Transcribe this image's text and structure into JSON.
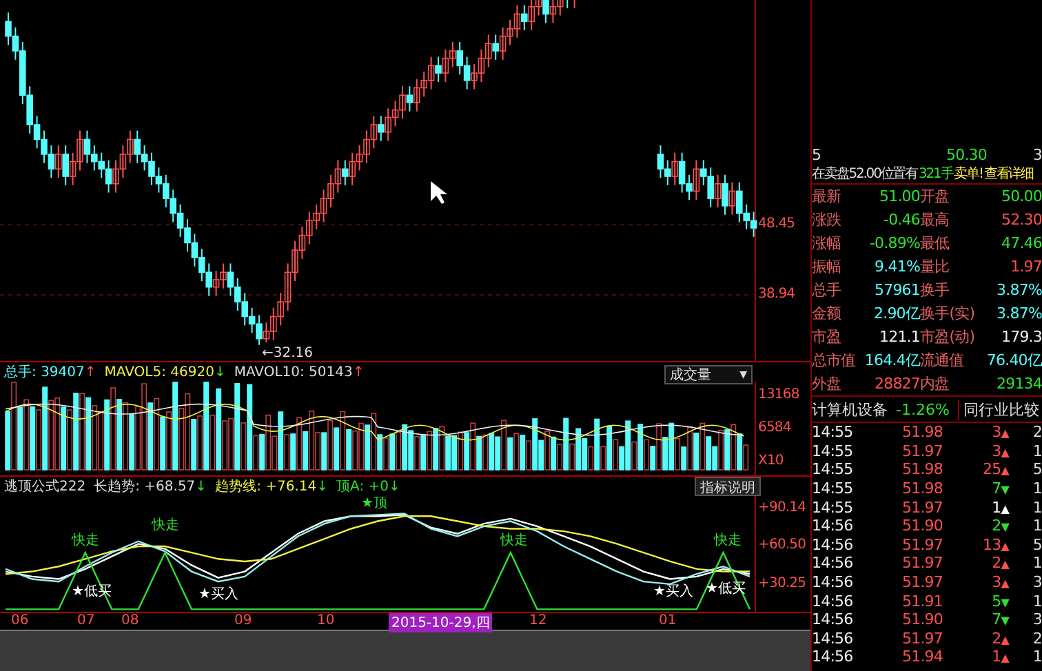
{
  "price_chart": {
    "chart_data": {
      "type": "candlestick",
      "ylim": [
        29.98,
        78.9
      ],
      "yticks": [
        {
          "value": 48.45,
          "label": "48.45"
        },
        {
          "value": 38.94,
          "label": "38.94"
        }
      ],
      "ohlc": [
        [
          76,
          77.2,
          72.8,
          74
        ],
        [
          74,
          75.2,
          70.8,
          72
        ],
        [
          72,
          73.2,
          64.8,
          66
        ],
        [
          66,
          67.2,
          60.8,
          62
        ],
        [
          62,
          63.2,
          58.8,
          60
        ],
        [
          60,
          61.2,
          56.8,
          58
        ],
        [
          58,
          59.2,
          54.8,
          56
        ],
        [
          56,
          59.2,
          54.8,
          58
        ],
        [
          58,
          59.2,
          53.8,
          55
        ],
        [
          55,
          58.2,
          53.8,
          57
        ],
        [
          57,
          61.2,
          55.8,
          60
        ],
        [
          60,
          61.2,
          56.8,
          58
        ],
        [
          58,
          59.2,
          55.8,
          57
        ],
        [
          57,
          58.2,
          54.8,
          56
        ],
        [
          56,
          57.2,
          52.8,
          54
        ],
        [
          54,
          57.2,
          52.8,
          56
        ],
        [
          56,
          59.2,
          54.8,
          58
        ],
        [
          58,
          61.2,
          56.8,
          60
        ],
        [
          60,
          61.2,
          56.8,
          58
        ],
        [
          58,
          59.2,
          55.8,
          57
        ],
        [
          57,
          58.2,
          53.8,
          55
        ],
        [
          55,
          56.2,
          52.8,
          54
        ],
        [
          54,
          55.2,
          50.8,
          52
        ],
        [
          52,
          53.2,
          48.8,
          50
        ],
        [
          50,
          51.2,
          46.8,
          48
        ],
        [
          48,
          49.2,
          44.8,
          46
        ],
        [
          46,
          47.2,
          42.8,
          44
        ],
        [
          44,
          45.2,
          40.8,
          42
        ],
        [
          42,
          43.2,
          38.8,
          40
        ],
        [
          40,
          42.2,
          38.8,
          41
        ],
        [
          41,
          43.2,
          39.8,
          42
        ],
        [
          42,
          43.2,
          38.8,
          40
        ],
        [
          40,
          41.2,
          36.8,
          38
        ],
        [
          38,
          39.2,
          34.8,
          36
        ],
        [
          36,
          37.2,
          33.8,
          35
        ],
        [
          35,
          36.2,
          32.16,
          33
        ],
        [
          33,
          35.2,
          32.5,
          34
        ],
        [
          34,
          37.2,
          32.8,
          36
        ],
        [
          36,
          39.2,
          34.8,
          38
        ],
        [
          38,
          43.2,
          36.8,
          42
        ],
        [
          42,
          46.2,
          40.8,
          45
        ],
        [
          45,
          48.2,
          43.8,
          47
        ],
        [
          47,
          50.2,
          45.8,
          49
        ],
        [
          49,
          51.2,
          47.8,
          50
        ],
        [
          50,
          53.2,
          48.8,
          52
        ],
        [
          52,
          55.2,
          50.8,
          54
        ],
        [
          54,
          57.2,
          52.8,
          56
        ],
        [
          56,
          57.2,
          53.8,
          55
        ],
        [
          55,
          58.2,
          53.8,
          57
        ],
        [
          57,
          59.2,
          55.8,
          58
        ],
        [
          58,
          61.2,
          56.8,
          60
        ],
        [
          60,
          63.2,
          58.8,
          62
        ],
        [
          62,
          63.2,
          59.8,
          61
        ],
        [
          61,
          64.2,
          59.8,
          63
        ],
        [
          63,
          65.2,
          61.8,
          64
        ],
        [
          64,
          67.2,
          62.8,
          66
        ],
        [
          66,
          67.2,
          63.8,
          65
        ],
        [
          65,
          68.2,
          63.8,
          67
        ],
        [
          67,
          69.2,
          65.8,
          68
        ],
        [
          68,
          71.2,
          66.8,
          70
        ],
        [
          70,
          71.2,
          67.8,
          69
        ],
        [
          69,
          72.2,
          67.8,
          71
        ],
        [
          71,
          73.2,
          69.8,
          72
        ],
        [
          72,
          73.2,
          68.8,
          70
        ],
        [
          70,
          71.2,
          66.8,
          68
        ],
        [
          68,
          70.2,
          66.8,
          69
        ],
        [
          69,
          72.2,
          67.8,
          71
        ],
        [
          71,
          74.2,
          69.8,
          73
        ],
        [
          73,
          74.2,
          70.8,
          72
        ],
        [
          72,
          75.2,
          70.8,
          74
        ],
        [
          74,
          76.2,
          72.8,
          75
        ],
        [
          75,
          78.2,
          73.8,
          77
        ],
        [
          77,
          78.2,
          74.8,
          76
        ],
        [
          76,
          79.2,
          74.8,
          78
        ],
        [
          78,
          80.2,
          76.8,
          79
        ],
        [
          79,
          80.2,
          75.8,
          77
        ],
        [
          77,
          79.2,
          75.8,
          78
        ],
        [
          78,
          81.2,
          76.8,
          80
        ],
        [
          80,
          81.2,
          77.8,
          79
        ],
        [
          79,
          82.2,
          77.8,
          81
        ],
        null,
        null,
        null,
        null,
        null,
        null,
        null,
        null,
        null,
        null,
        null,
        [
          58,
          59.2,
          54.8,
          56
        ],
        [
          56,
          57.2,
          53.8,
          55
        ],
        [
          55,
          58.2,
          53.8,
          57
        ],
        [
          57,
          58.2,
          52.8,
          54
        ],
        [
          54,
          55.2,
          51.8,
          53
        ],
        [
          53,
          57.2,
          51.8,
          56
        ],
        [
          56,
          57.2,
          53.8,
          55
        ],
        [
          55,
          56.2,
          50.8,
          52
        ],
        [
          52,
          55.2,
          50.8,
          54
        ],
        [
          54,
          55.2,
          49.8,
          51
        ],
        [
          51,
          54.2,
          49.8,
          53
        ],
        [
          53,
          54.2,
          48.8,
          50
        ],
        [
          50,
          51.2,
          47.8,
          49
        ],
        [
          49,
          50.2,
          46.8,
          48
        ]
      ]
    },
    "low_label": "←32.16"
  },
  "volume_panel": {
    "header": [
      {
        "label": "总手:",
        "value": "39407",
        "arrow": "↑",
        "rising": true
      },
      {
        "label": "MAVOL5:",
        "value": "46920",
        "arrow": "↓",
        "rising": false
      },
      {
        "label": "MAVOL10:",
        "value": "50143",
        "arrow": "↑",
        "rising": true
      }
    ],
    "dropdown": "成交量",
    "dropdown_arrow": "▼",
    "axis_labels": [
      "13168",
      "6584",
      "X10"
    ]
  },
  "indicator_panel": {
    "name": "逃顶公式222",
    "header": [
      {
        "label": "长趋势:",
        "value": "+68.57",
        "arrow": "↓",
        "rising": false
      },
      {
        "label": "趋势线:",
        "value": "+76.14",
        "arrow": "↓",
        "rising": false
      },
      {
        "label": "顶A:",
        "value": "+0",
        "arrow": "↓",
        "rising": false
      }
    ],
    "help_button": "指标说明",
    "chart_data": {
      "type": "line",
      "ylim": [
        8,
        100
      ],
      "yticks": [
        {
          "value": 90.14,
          "label": "+90.14"
        },
        {
          "value": 60.5,
          "label": "+60.50"
        },
        {
          "value": 30.25,
          "label": "+30.25"
        }
      ],
      "series": [
        {
          "color": "#ffffff",
          "values": [
            40,
            36,
            34,
            42,
            52,
            62,
            58,
            45,
            35,
            40,
            55,
            70,
            80,
            84,
            84,
            85,
            75,
            70,
            78,
            82,
            76,
            68,
            60,
            50,
            40,
            34,
            36,
            42,
            38
          ]
        },
        {
          "color": "#f0f040",
          "values": [
            38,
            40,
            44,
            50,
            56,
            60,
            60,
            55,
            50,
            48,
            50,
            58,
            66,
            74,
            80,
            84,
            84,
            80,
            76,
            74,
            74,
            72,
            68,
            62,
            55,
            48,
            42,
            40,
            40
          ]
        },
        {
          "color": "#99eeee",
          "values": [
            42,
            34,
            32,
            44,
            55,
            64,
            56,
            40,
            32,
            36,
            52,
            68,
            78,
            84,
            85,
            86,
            74,
            68,
            76,
            80,
            72,
            60,
            50,
            40,
            32,
            30,
            38,
            44,
            36
          ]
        },
        {
          "color": "#30e030",
          "values": [
            10,
            10,
            10,
            55,
            10,
            10,
            55,
            10,
            10,
            10,
            10,
            10,
            10,
            10,
            10,
            10,
            10,
            10,
            10,
            55,
            10,
            10,
            10,
            10,
            10,
            10,
            10,
            55,
            10
          ]
        }
      ]
    },
    "markers": [
      {
        "kind": "top",
        "label": "★顶"
      },
      {
        "kind": "sell",
        "label": "快走"
      },
      {
        "kind": "sell",
        "label": "快走"
      },
      {
        "kind": "sell",
        "label": "快走"
      },
      {
        "kind": "sell",
        "label": "快走"
      },
      {
        "kind": "buy",
        "label": "★低买"
      },
      {
        "kind": "buy",
        "label": "★买入"
      },
      {
        "kind": "buy",
        "label": "★买入"
      },
      {
        "kind": "buy",
        "label": "★低买"
      }
    ]
  },
  "date_axis": [
    {
      "label": "06",
      "selected": false
    },
    {
      "label": "07",
      "selected": false
    },
    {
      "label": "08",
      "selected": false
    },
    {
      "label": "09",
      "selected": false
    },
    {
      "label": "10",
      "selected": false
    },
    {
      "label": "2015-10-29,四",
      "selected": true
    },
    {
      "label": "12",
      "selected": false
    },
    {
      "label": "01",
      "selected": false
    }
  ],
  "quote_panel": {
    "order_row": [
      "5",
      "50.30",
      "3"
    ],
    "notice": {
      "text": "在卖盘52.00位置有",
      "volume": "321手",
      "alert": "卖单!",
      "link": "查看详细"
    },
    "stats": [
      {
        "label": "最新",
        "value": "51.00",
        "color": "#30e030"
      },
      {
        "label": "开盘",
        "value": "50.00",
        "color": "#30e030"
      },
      {
        "label": "涨跌",
        "value": "-0.46",
        "color": "#30e030"
      },
      {
        "label": "最高",
        "value": "52.30",
        "color": "#ff5050"
      },
      {
        "label": "涨幅",
        "value": "-0.89%",
        "color": "#30e030"
      },
      {
        "label": "最低",
        "value": "47.46",
        "color": "#30e030"
      },
      {
        "label": "振幅",
        "value": "9.41%",
        "color": "#54fcfc"
      },
      {
        "label": "量比",
        "value": "1.97",
        "color": "#ff5050"
      },
      {
        "label": "总手",
        "value": "57961",
        "color": "#54fcfc"
      },
      {
        "label": "换手",
        "value": "3.87%",
        "color": "#54fcfc"
      },
      {
        "label": "金额",
        "value": "2.90亿",
        "color": "#54fcfc"
      },
      {
        "label": "换手(实)",
        "value": "3.87%",
        "color": "#54fcfc"
      },
      {
        "label": "市盈",
        "value": "121.1",
        "color": "#f0f0f0"
      },
      {
        "label": "市盈(动)",
        "value": "179.3",
        "color": "#f0f0f0"
      },
      {
        "label": "总市值",
        "value": "164.4亿",
        "color": "#54fcfc"
      },
      {
        "label": "流通值",
        "value": "76.40亿",
        "color": "#54fcfc"
      },
      {
        "label": "外盘",
        "value": "28827",
        "color": "#ff5050"
      },
      {
        "label": "内盘",
        "value": "29134",
        "color": "#30e030"
      }
    ],
    "industry": {
      "name": "计算机设备",
      "change": "-1.26%",
      "button": "同行业比较"
    },
    "trades": [
      {
        "time": "14:55",
        "price": "51.98",
        "volume": "3",
        "arrow": "▲",
        "color": "#ff5050",
        "count": "2"
      },
      {
        "time": "14:55",
        "price": "51.97",
        "volume": "3",
        "arrow": "▲",
        "color": "#ff5050",
        "count": "1"
      },
      {
        "time": "14:55",
        "price": "51.98",
        "volume": "25",
        "arrow": "▲",
        "color": "#ff5050",
        "count": "5"
      },
      {
        "time": "14:55",
        "price": "51.98",
        "volume": "7",
        "arrow": "▼",
        "color": "#30e030",
        "count": "1"
      },
      {
        "time": "14:55",
        "price": "51.97",
        "volume": "1",
        "arrow": "▲",
        "color": "#ffffff",
        "count": "1"
      },
      {
        "time": "14:56",
        "price": "51.90",
        "volume": "2",
        "arrow": "▼",
        "color": "#30e030",
        "count": "1"
      },
      {
        "time": "14:56",
        "price": "51.97",
        "volume": "13",
        "arrow": "▲",
        "color": "#ff5050",
        "count": "5"
      },
      {
        "time": "14:56",
        "price": "51.97",
        "volume": "2",
        "arrow": "▲",
        "color": "#ff5050",
        "count": "1"
      },
      {
        "time": "14:56",
        "price": "51.97",
        "volume": "3",
        "arrow": "▲",
        "color": "#ff5050",
        "count": "3"
      },
      {
        "time": "14:56",
        "price": "51.91",
        "volume": "5",
        "arrow": "▼",
        "color": "#30e030",
        "count": "1"
      },
      {
        "time": "14:56",
        "price": "51.90",
        "volume": "7",
        "arrow": "▼",
        "color": "#30e030",
        "count": "3"
      },
      {
        "time": "14:56",
        "price": "51.97",
        "volume": "2",
        "arrow": "▲",
        "color": "#ff5050",
        "count": "2"
      },
      {
        "time": "14:56",
        "price": "51.94",
        "volume": "1",
        "arrow": "▲",
        "color": "#ff5050",
        "count": "1"
      }
    ]
  }
}
